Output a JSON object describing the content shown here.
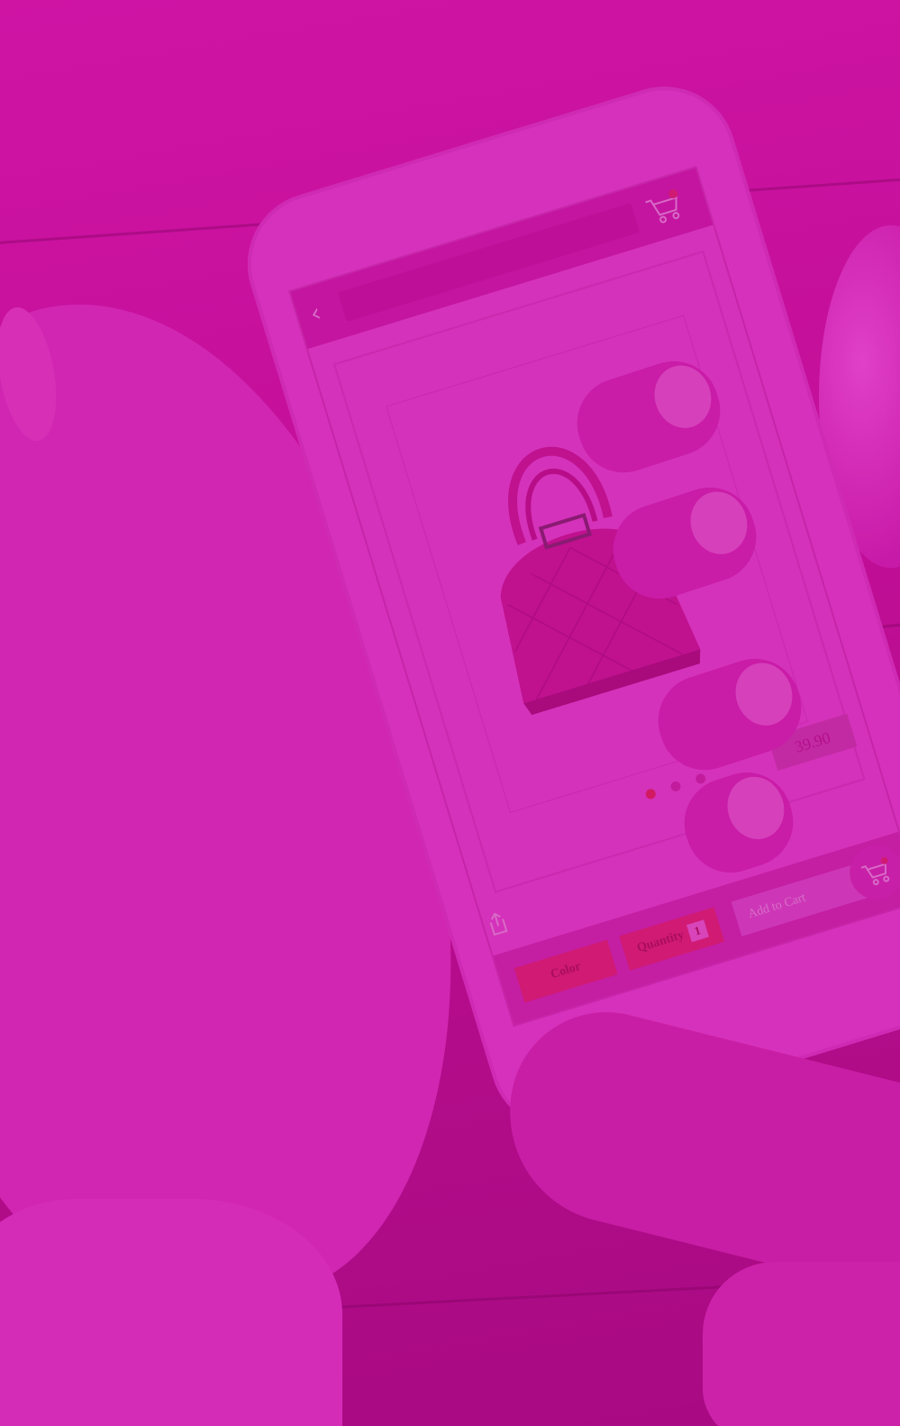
{
  "product": {
    "price": "39.90",
    "carousel_count": 3,
    "carousel_active": 1
  },
  "actions": {
    "color_label": "Color",
    "quantity_label": "Quantity",
    "quantity_value": "1",
    "add_to_cart_label": "Add to Cart"
  },
  "icons": {
    "back": "chevron-left-icon",
    "cart_top": "cart-icon",
    "share": "share-icon",
    "cart_add": "cart-plus-icon"
  },
  "colors": {
    "overlay": "#c10f97",
    "accent": "#d01a74"
  }
}
